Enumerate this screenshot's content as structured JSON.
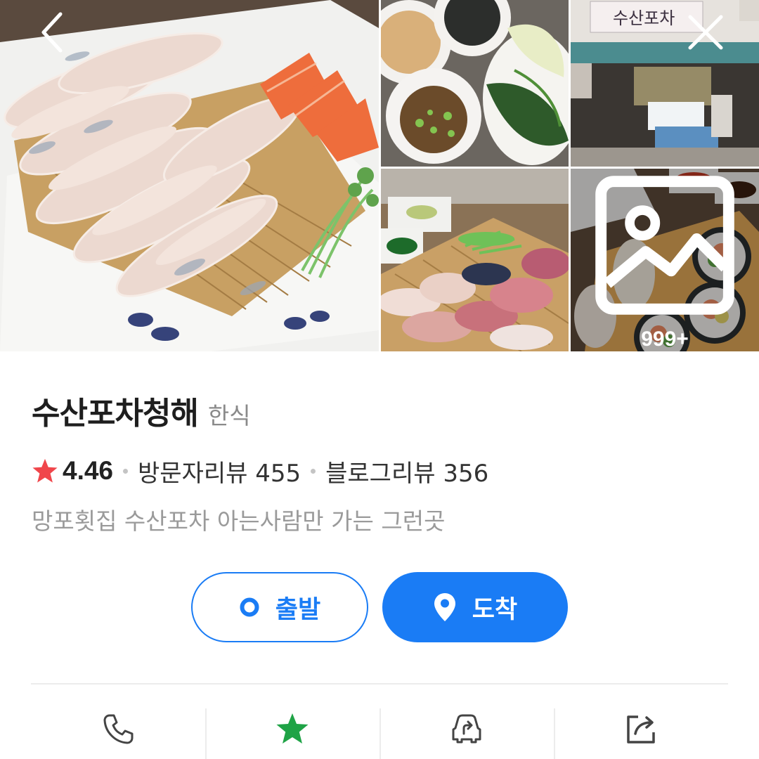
{
  "gallery": {
    "photos": [
      {
        "name": "sliced-raw-fish-platter"
      },
      {
        "name": "side-dishes-and-greens"
      },
      {
        "name": "restaurant-storefront",
        "sign_text": "수산포차"
      },
      {
        "name": "assorted-sashimi-board"
      },
      {
        "name": "sushi-and-rolls"
      }
    ],
    "more_count": "999+"
  },
  "header": {
    "back_icon": "chevron-left-icon",
    "close_icon": "close-icon"
  },
  "place": {
    "name": "수산포차청해",
    "category": "한식",
    "rating": "4.46",
    "visitor_reviews": "방문자리뷰 455",
    "blog_reviews": "블로그리뷰 356",
    "description": "망포횟집 수산포차 아는사람만 가는 그런곳"
  },
  "route": {
    "origin_label": "출발",
    "destination_label": "도착"
  },
  "actions": [
    {
      "icon": "phone-icon"
    },
    {
      "icon": "star-icon"
    },
    {
      "icon": "car-directions-icon"
    },
    {
      "icon": "share-icon"
    }
  ],
  "colors": {
    "accent": "#1a7cf5",
    "rating_star": "#f0464b",
    "save_star": "#1fa346",
    "muted_text": "#9a9a9a"
  }
}
